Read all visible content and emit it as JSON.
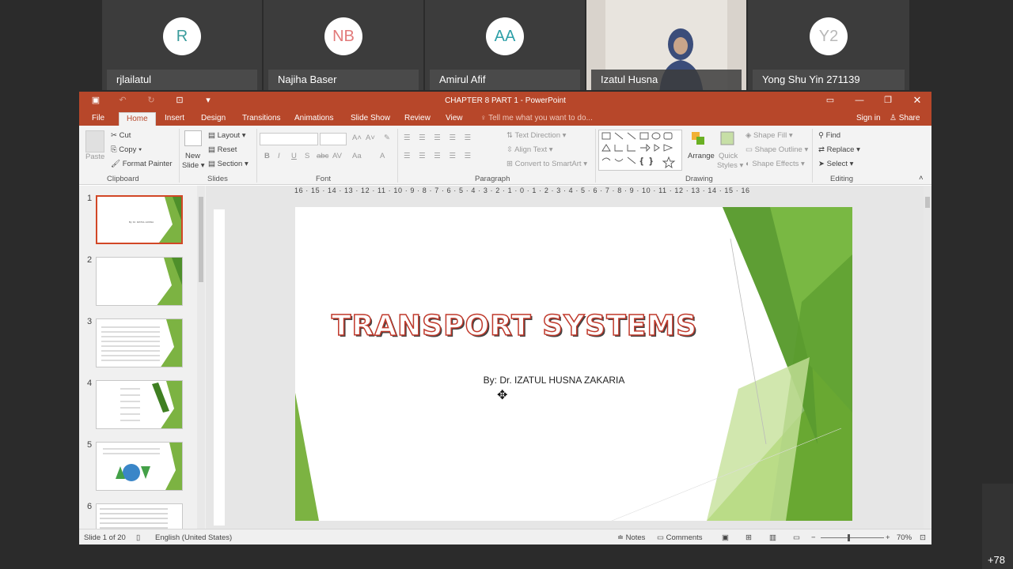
{
  "participants": [
    {
      "initials": "R",
      "name": "rjlailatul",
      "color": "#3a9c9c"
    },
    {
      "initials": "NB",
      "name": "Najiha Baser",
      "color": "#e27a7a"
    },
    {
      "initials": "AA",
      "name": "Amirul Afif",
      "color": "#2ea0a8"
    },
    {
      "initials": "",
      "name": "Izatul Husna",
      "color": "#d9d3cc"
    },
    {
      "initials": "Y2",
      "name": "Yong Shu Yin 271139",
      "color": "#b8b8b8"
    }
  ],
  "more_participants": "+78",
  "window": {
    "title": "CHAPTER 8 PART 1 - PowerPoint"
  },
  "tabs": [
    "File",
    "Home",
    "Insert",
    "Design",
    "Transitions",
    "Animations",
    "Slide Show",
    "Review",
    "View"
  ],
  "tell_me": "Tell me what you want to do...",
  "sign_in": "Sign in",
  "share": "Share",
  "ribbon": {
    "clipboard": {
      "paste": "Paste",
      "cut": "Cut",
      "copy": "Copy",
      "format_painter": "Format Painter",
      "label": "Clipboard"
    },
    "slides": {
      "new_slide": "New",
      "new_slide2": "Slide",
      "layout": "Layout",
      "reset": "Reset",
      "section": "Section",
      "label": "Slides"
    },
    "font": {
      "label": "Font",
      "bold": "B",
      "italic": "I",
      "underline": "U",
      "strike": "S",
      "abc": "abc",
      "av": "AV",
      "aa": "Aa",
      "a": "A"
    },
    "paragraph": {
      "text_direction": "Text Direction",
      "align_text": "Align Text",
      "convert": "Convert to SmartArt",
      "label": "Paragraph"
    },
    "drawing": {
      "arrange": "Arrange",
      "quick_styles": "Quick",
      "quick_styles2": "Styles",
      "shape_fill": "Shape Fill",
      "shape_outline": "Shape Outline",
      "shape_effects": "Shape Effects",
      "label": "Drawing"
    },
    "editing": {
      "find": "Find",
      "replace": "Replace",
      "select": "Select",
      "label": "Editing"
    }
  },
  "thumbnails": [
    {
      "num": "1",
      "text": "TRANSPORT SYSTEMS"
    },
    {
      "num": "2",
      "text": ""
    },
    {
      "num": "3",
      "text": "VARIOUS ELEMENTS OF TRANSPORTATION"
    },
    {
      "num": "4",
      "text": "Highway/road · Railroad · Air Transport · Water Transport · Pipelines · Water Carrier"
    },
    {
      "num": "5",
      "text": ""
    },
    {
      "num": "6",
      "text": "Highway - Motor Vehicle system"
    }
  ],
  "ruler_ticks": "16 · 15 · 14 · 13 · 12 · 11 · 10 · 9 · 8 · 7 · 6 · 5 · 4 · 3 · 2 · 1 · 0 · 1 · 2 · 3 · 4 · 5 · 6 · 7 · 8 · 9 · 10 · 11 · 12 · 13 · 14 · 15 · 16",
  "slide": {
    "title": "TRANSPORT SYSTEMS",
    "subtitle": "By: Dr. IZATUL HUSNA ZAKARIA"
  },
  "status": {
    "slide_info": "Slide 1 of 20",
    "language": "English (United States)",
    "notes": "Notes",
    "comments": "Comments",
    "zoom": "70%"
  },
  "colors": {
    "accent": "#b7472a",
    "green": "#6ab023"
  }
}
